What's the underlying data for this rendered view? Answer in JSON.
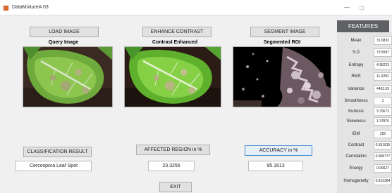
{
  "window": {
    "title": "DataMixtureA 03"
  },
  "buttons": {
    "load": "LOAD IMAGE",
    "enhance": "ENHANCE CONTRAST",
    "segment": "SEGMENT IMAGE",
    "classification": "CLASSIFICATION RESULT",
    "affected": "AFFECTED REGION in %",
    "accuracy": "ACCURACY in %",
    "exit": "EXIT"
  },
  "captions": {
    "query": "Query Image",
    "enhanced": "Contrast Enhanced",
    "segmented": "Segmented ROI"
  },
  "results": {
    "classification": "Cercospora Leaf Spot",
    "affected": "23.3255",
    "accuracy": "95.1613"
  },
  "features": {
    "header": "FEATURES",
    "rows": [
      {
        "label": "Mean",
        "value": "31.6832"
      },
      {
        "label": "S.D",
        "value": "73.5587"
      },
      {
        "label": "Entropy",
        "value": "4.95223"
      },
      {
        "label": "RMS",
        "value": "11.9282"
      },
      {
        "label": "Variance",
        "value": "4403.03"
      },
      {
        "label": "Smoothness",
        "value": "1"
      },
      {
        "label": "Kurtosis",
        "value": "3.79672"
      },
      {
        "label": "Skewness",
        "value": "1.37870"
      },
      {
        "label": "IDM",
        "value": "255"
      },
      {
        "label": "Contrast",
        "value": "0.551815"
      },
      {
        "label": "Correlation",
        "value": "0.968777"
      },
      {
        "label": "Energy",
        "value": "0.00627"
      },
      {
        "label": "Homogeneity",
        "value": "0.913384"
      }
    ]
  }
}
